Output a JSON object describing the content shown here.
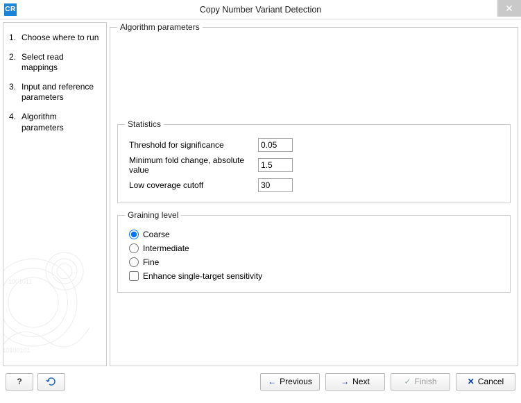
{
  "window": {
    "app_icon_text": "CR",
    "title": "Copy Number Variant Detection"
  },
  "sidebar": {
    "steps": [
      "Choose where to run",
      "Select read mappings",
      "Input and reference parameters",
      "Algorithm parameters"
    ]
  },
  "panel": {
    "legend": "Algorithm parameters",
    "statistics": {
      "legend": "Statistics",
      "threshold_label": "Threshold for significance",
      "threshold_value": "0.05",
      "minfold_label": "Minimum fold change, absolute value",
      "minfold_value": "1.5",
      "lowcov_label": "Low coverage cutoff",
      "lowcov_value": "30"
    },
    "graining": {
      "legend": "Graining level",
      "coarse": "Coarse",
      "intermediate": "Intermediate",
      "fine": "Fine",
      "enhance": "Enhance single-target sensitivity",
      "selected": "coarse",
      "enhance_checked": false
    }
  },
  "buttons": {
    "help": "?",
    "previous": "Previous",
    "next": "Next",
    "finish": "Finish",
    "cancel": "Cancel"
  }
}
